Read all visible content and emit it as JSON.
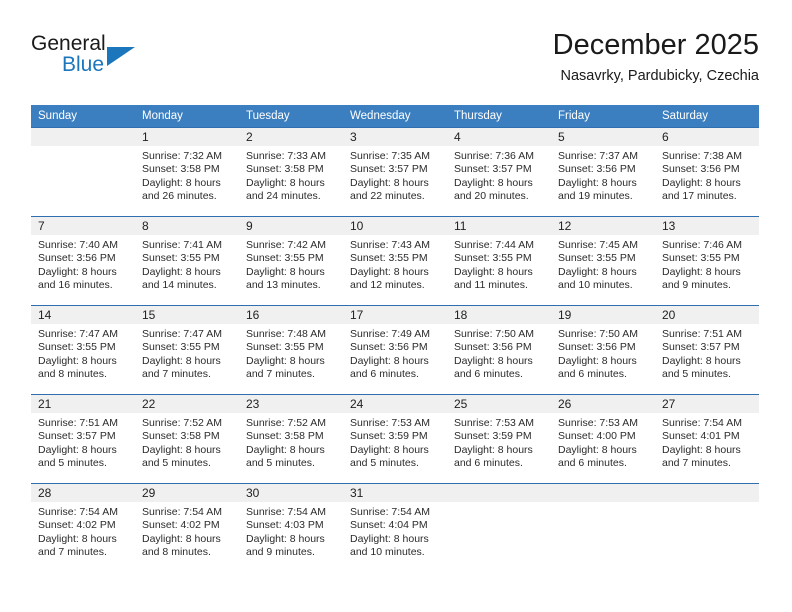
{
  "brand": {
    "general": "General",
    "blue": "Blue"
  },
  "header": {
    "month_title": "December 2025",
    "location": "Nasavrky, Pardubicky, Czechia"
  },
  "colors": {
    "header_blue": "#3c7fc0",
    "rule_blue": "#2f6fb0",
    "daynum_band": "#f0f0f0",
    "brand_blue": "#1b76bc",
    "text": "#222222"
  },
  "calendar": {
    "weekday_headers": [
      "Sunday",
      "Monday",
      "Tuesday",
      "Wednesday",
      "Thursday",
      "Friday",
      "Saturday"
    ],
    "labels": {
      "sunrise": "Sunrise:",
      "sunset": "Sunset:",
      "daylight": "Daylight:"
    },
    "weeks": [
      [
        {
          "day": "",
          "blank": true
        },
        {
          "day": "1",
          "sunrise": "Sunrise: 7:32 AM",
          "sunset": "Sunset: 3:58 PM",
          "daylight1": "Daylight: 8 hours",
          "daylight2": "and 26 minutes."
        },
        {
          "day": "2",
          "sunrise": "Sunrise: 7:33 AM",
          "sunset": "Sunset: 3:58 PM",
          "daylight1": "Daylight: 8 hours",
          "daylight2": "and 24 minutes."
        },
        {
          "day": "3",
          "sunrise": "Sunrise: 7:35 AM",
          "sunset": "Sunset: 3:57 PM",
          "daylight1": "Daylight: 8 hours",
          "daylight2": "and 22 minutes."
        },
        {
          "day": "4",
          "sunrise": "Sunrise: 7:36 AM",
          "sunset": "Sunset: 3:57 PM",
          "daylight1": "Daylight: 8 hours",
          "daylight2": "and 20 minutes."
        },
        {
          "day": "5",
          "sunrise": "Sunrise: 7:37 AM",
          "sunset": "Sunset: 3:56 PM",
          "daylight1": "Daylight: 8 hours",
          "daylight2": "and 19 minutes."
        },
        {
          "day": "6",
          "sunrise": "Sunrise: 7:38 AM",
          "sunset": "Sunset: 3:56 PM",
          "daylight1": "Daylight: 8 hours",
          "daylight2": "and 17 minutes."
        }
      ],
      [
        {
          "day": "7",
          "sunrise": "Sunrise: 7:40 AM",
          "sunset": "Sunset: 3:56 PM",
          "daylight1": "Daylight: 8 hours",
          "daylight2": "and 16 minutes."
        },
        {
          "day": "8",
          "sunrise": "Sunrise: 7:41 AM",
          "sunset": "Sunset: 3:55 PM",
          "daylight1": "Daylight: 8 hours",
          "daylight2": "and 14 minutes."
        },
        {
          "day": "9",
          "sunrise": "Sunrise: 7:42 AM",
          "sunset": "Sunset: 3:55 PM",
          "daylight1": "Daylight: 8 hours",
          "daylight2": "and 13 minutes."
        },
        {
          "day": "10",
          "sunrise": "Sunrise: 7:43 AM",
          "sunset": "Sunset: 3:55 PM",
          "daylight1": "Daylight: 8 hours",
          "daylight2": "and 12 minutes."
        },
        {
          "day": "11",
          "sunrise": "Sunrise: 7:44 AM",
          "sunset": "Sunset: 3:55 PM",
          "daylight1": "Daylight: 8 hours",
          "daylight2": "and 11 minutes."
        },
        {
          "day": "12",
          "sunrise": "Sunrise: 7:45 AM",
          "sunset": "Sunset: 3:55 PM",
          "daylight1": "Daylight: 8 hours",
          "daylight2": "and 10 minutes."
        },
        {
          "day": "13",
          "sunrise": "Sunrise: 7:46 AM",
          "sunset": "Sunset: 3:55 PM",
          "daylight1": "Daylight: 8 hours",
          "daylight2": "and 9 minutes."
        }
      ],
      [
        {
          "day": "14",
          "sunrise": "Sunrise: 7:47 AM",
          "sunset": "Sunset: 3:55 PM",
          "daylight1": "Daylight: 8 hours",
          "daylight2": "and 8 minutes."
        },
        {
          "day": "15",
          "sunrise": "Sunrise: 7:47 AM",
          "sunset": "Sunset: 3:55 PM",
          "daylight1": "Daylight: 8 hours",
          "daylight2": "and 7 minutes."
        },
        {
          "day": "16",
          "sunrise": "Sunrise: 7:48 AM",
          "sunset": "Sunset: 3:55 PM",
          "daylight1": "Daylight: 8 hours",
          "daylight2": "and 7 minutes."
        },
        {
          "day": "17",
          "sunrise": "Sunrise: 7:49 AM",
          "sunset": "Sunset: 3:56 PM",
          "daylight1": "Daylight: 8 hours",
          "daylight2": "and 6 minutes."
        },
        {
          "day": "18",
          "sunrise": "Sunrise: 7:50 AM",
          "sunset": "Sunset: 3:56 PM",
          "daylight1": "Daylight: 8 hours",
          "daylight2": "and 6 minutes."
        },
        {
          "day": "19",
          "sunrise": "Sunrise: 7:50 AM",
          "sunset": "Sunset: 3:56 PM",
          "daylight1": "Daylight: 8 hours",
          "daylight2": "and 6 minutes."
        },
        {
          "day": "20",
          "sunrise": "Sunrise: 7:51 AM",
          "sunset": "Sunset: 3:57 PM",
          "daylight1": "Daylight: 8 hours",
          "daylight2": "and 5 minutes."
        }
      ],
      [
        {
          "day": "21",
          "sunrise": "Sunrise: 7:51 AM",
          "sunset": "Sunset: 3:57 PM",
          "daylight1": "Daylight: 8 hours",
          "daylight2": "and 5 minutes."
        },
        {
          "day": "22",
          "sunrise": "Sunrise: 7:52 AM",
          "sunset": "Sunset: 3:58 PM",
          "daylight1": "Daylight: 8 hours",
          "daylight2": "and 5 minutes."
        },
        {
          "day": "23",
          "sunrise": "Sunrise: 7:52 AM",
          "sunset": "Sunset: 3:58 PM",
          "daylight1": "Daylight: 8 hours",
          "daylight2": "and 5 minutes."
        },
        {
          "day": "24",
          "sunrise": "Sunrise: 7:53 AM",
          "sunset": "Sunset: 3:59 PM",
          "daylight1": "Daylight: 8 hours",
          "daylight2": "and 5 minutes."
        },
        {
          "day": "25",
          "sunrise": "Sunrise: 7:53 AM",
          "sunset": "Sunset: 3:59 PM",
          "daylight1": "Daylight: 8 hours",
          "daylight2": "and 6 minutes."
        },
        {
          "day": "26",
          "sunrise": "Sunrise: 7:53 AM",
          "sunset": "Sunset: 4:00 PM",
          "daylight1": "Daylight: 8 hours",
          "daylight2": "and 6 minutes."
        },
        {
          "day": "27",
          "sunrise": "Sunrise: 7:54 AM",
          "sunset": "Sunset: 4:01 PM",
          "daylight1": "Daylight: 8 hours",
          "daylight2": "and 7 minutes."
        }
      ],
      [
        {
          "day": "28",
          "sunrise": "Sunrise: 7:54 AM",
          "sunset": "Sunset: 4:02 PM",
          "daylight1": "Daylight: 8 hours",
          "daylight2": "and 7 minutes."
        },
        {
          "day": "29",
          "sunrise": "Sunrise: 7:54 AM",
          "sunset": "Sunset: 4:02 PM",
          "daylight1": "Daylight: 8 hours",
          "daylight2": "and 8 minutes."
        },
        {
          "day": "30",
          "sunrise": "Sunrise: 7:54 AM",
          "sunset": "Sunset: 4:03 PM",
          "daylight1": "Daylight: 8 hours",
          "daylight2": "and 9 minutes."
        },
        {
          "day": "31",
          "sunrise": "Sunrise: 7:54 AM",
          "sunset": "Sunset: 4:04 PM",
          "daylight1": "Daylight: 8 hours",
          "daylight2": "and 10 minutes."
        },
        {
          "day": "",
          "blank": true
        },
        {
          "day": "",
          "blank": true
        },
        {
          "day": "",
          "blank": true
        }
      ]
    ]
  }
}
